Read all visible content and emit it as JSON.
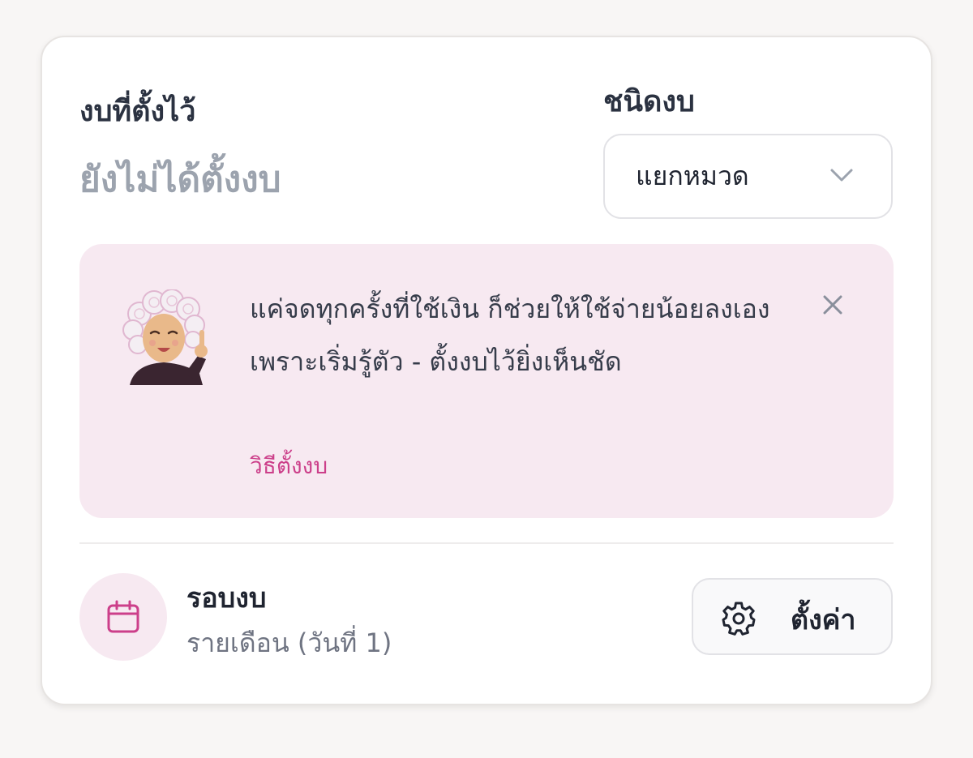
{
  "budget": {
    "label": "งบที่ตั้งไว้",
    "value": "ยังไม่ได้ตั้งงบ"
  },
  "budget_type": {
    "label": "ชนิดงบ",
    "selected": "แยกหมวด"
  },
  "tip": {
    "message": "แค่จดทุกครั้งที่ใช้เงิน ก็ช่วยให้ใช้จ่ายน้อยลงเอง เพราะเริ่มรู้ตัว - ตั้งงบไว้ยิ่งเห็นชัด",
    "link": "วิธีตั้งงบ"
  },
  "cycle": {
    "title": "รอบงบ",
    "value": "รายเดือน (วันที่ 1)"
  },
  "settings": {
    "label": "ตั้งค่า"
  },
  "colors": {
    "accent_pink": "#cc3f8a",
    "tip_background": "#f7e9f1",
    "muted_text": "#9ca3ae"
  },
  "icons": [
    "chevron-down-icon",
    "close-icon",
    "calendar-icon",
    "gear-icon",
    "avatar"
  ]
}
